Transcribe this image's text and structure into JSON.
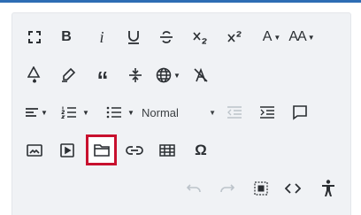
{
  "toolbar": {
    "bold_label": "B",
    "italic_label": "i",
    "text_color_label": "A",
    "font_size_label": "AA",
    "format_select_value": "Normal",
    "selected_border_color": "#c8102e",
    "accent_color": "#2e6db4"
  },
  "icons": [
    "fullscreen-icon",
    "bold-icon",
    "italic-icon",
    "underline-icon",
    "strikethrough-icon",
    "subscript-icon",
    "superscript-icon",
    "text-color-icon",
    "font-size-icon",
    "fill-color-icon",
    "highlight-icon",
    "blockquote-icon",
    "horizontal-rule-icon",
    "language-icon",
    "clear-formatting-icon",
    "align-icon",
    "numbered-list-icon",
    "bulleted-list-icon",
    "outdent-icon",
    "indent-icon",
    "comment-icon",
    "image-icon",
    "media-icon",
    "file-manager-icon",
    "link-icon",
    "table-icon",
    "special-characters-icon",
    "undo-icon",
    "redo-icon",
    "select-all-icon",
    "source-code-icon",
    "accessibility-icon"
  ]
}
